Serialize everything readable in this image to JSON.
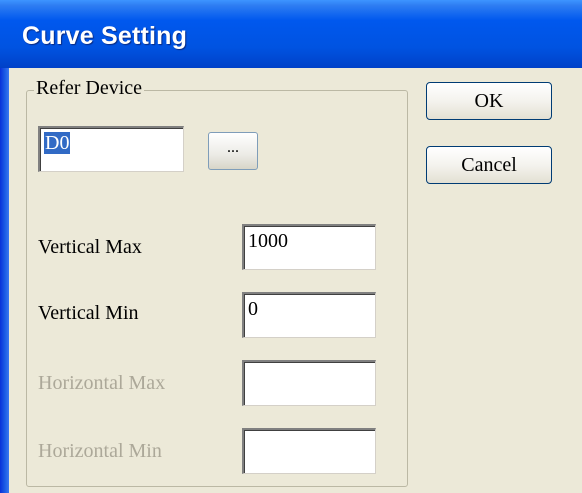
{
  "window": {
    "title": "Curve Setting"
  },
  "refer_device": {
    "group_label": "Refer Device",
    "device_value": "D0",
    "browse_label": "..."
  },
  "buttons": {
    "ok": "OK",
    "cancel": "Cancel"
  },
  "fields": {
    "vertical_max": {
      "label": "Vertical Max",
      "value": "1000"
    },
    "vertical_min": {
      "label": "Vertical Min",
      "value": "0"
    },
    "horizontal_max": {
      "label": "Horizontal Max",
      "value": ""
    },
    "horizontal_min": {
      "label": "Horizontal Min",
      "value": ""
    }
  }
}
